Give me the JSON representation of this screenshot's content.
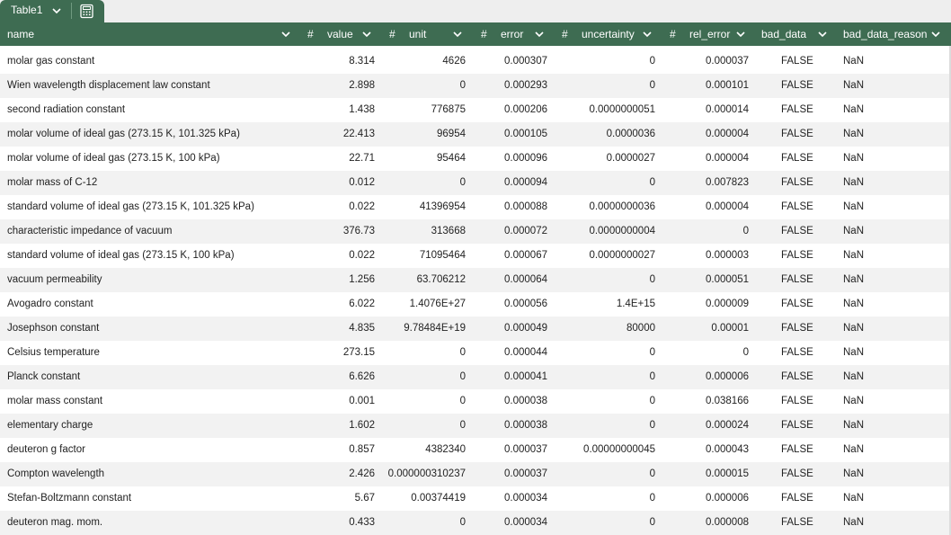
{
  "tab": {
    "label": "Table1"
  },
  "headers": {
    "name": "name",
    "value": "value",
    "unit": "unit",
    "error": "error",
    "uncertainty": "uncertainty",
    "rel_error": "rel_error",
    "bad_data": "bad_data",
    "bad_data_reason": "bad_data_reason",
    "hash": "#"
  },
  "rows": [
    {
      "name": "molar gas constant",
      "value": "8.314",
      "unit": "4626",
      "error": "0.000307",
      "uncertainty": "0",
      "rel_error": "0.000037",
      "bad_data": "FALSE",
      "bad_data_reason": "NaN"
    },
    {
      "name": "Wien wavelength displacement law constant",
      "value": "2.898",
      "unit": "0",
      "error": "0.000293",
      "uncertainty": "0",
      "rel_error": "0.000101",
      "bad_data": "FALSE",
      "bad_data_reason": "NaN"
    },
    {
      "name": "second radiation constant",
      "value": "1.438",
      "unit": "776875",
      "error": "0.000206",
      "uncertainty": "0.0000000051",
      "rel_error": "0.000014",
      "bad_data": "FALSE",
      "bad_data_reason": "NaN"
    },
    {
      "name": "molar volume of ideal gas (273.15 K, 101.325 kPa)",
      "value": "22.413",
      "unit": "96954",
      "error": "0.000105",
      "uncertainty": "0.0000036",
      "rel_error": "0.000004",
      "bad_data": "FALSE",
      "bad_data_reason": "NaN"
    },
    {
      "name": "molar volume of ideal gas (273.15 K, 100 kPa)",
      "value": "22.71",
      "unit": "95464",
      "error": "0.000096",
      "uncertainty": "0.0000027",
      "rel_error": "0.000004",
      "bad_data": "FALSE",
      "bad_data_reason": "NaN"
    },
    {
      "name": "molar mass of C-12",
      "value": "0.012",
      "unit": "0",
      "error": "0.000094",
      "uncertainty": "0",
      "rel_error": "0.007823",
      "bad_data": "FALSE",
      "bad_data_reason": "NaN"
    },
    {
      "name": "standard volume of ideal gas (273.15 K, 101.325 kPa)",
      "value": "0.022",
      "unit": "41396954",
      "error": "0.000088",
      "uncertainty": "0.0000000036",
      "rel_error": "0.000004",
      "bad_data": "FALSE",
      "bad_data_reason": "NaN"
    },
    {
      "name": "characteristic impedance of vacuum",
      "value": "376.73",
      "unit": "313668",
      "error": "0.000072",
      "uncertainty": "0.0000000004",
      "rel_error": "0",
      "bad_data": "FALSE",
      "bad_data_reason": "NaN"
    },
    {
      "name": "standard volume of ideal gas (273.15 K, 100 kPa)",
      "value": "0.022",
      "unit": "71095464",
      "error": "0.000067",
      "uncertainty": "0.0000000027",
      "rel_error": "0.000003",
      "bad_data": "FALSE",
      "bad_data_reason": "NaN"
    },
    {
      "name": "vacuum permeability",
      "value": "1.256",
      "unit": "63.706212",
      "error": "0.000064",
      "uncertainty": "0",
      "rel_error": "0.000051",
      "bad_data": "FALSE",
      "bad_data_reason": "NaN"
    },
    {
      "name": "Avogadro constant",
      "value": "6.022",
      "unit": "1.4076E+27",
      "error": "0.000056",
      "uncertainty": "1.4E+15",
      "rel_error": "0.000009",
      "bad_data": "FALSE",
      "bad_data_reason": "NaN"
    },
    {
      "name": "Josephson constant",
      "value": "4.835",
      "unit": "9.78484E+19",
      "error": "0.000049",
      "uncertainty": "80000",
      "rel_error": "0.00001",
      "bad_data": "FALSE",
      "bad_data_reason": "NaN"
    },
    {
      "name": "Celsius temperature",
      "value": "273.15",
      "unit": "0",
      "error": "0.000044",
      "uncertainty": "0",
      "rel_error": "0",
      "bad_data": "FALSE",
      "bad_data_reason": "NaN"
    },
    {
      "name": "Planck constant",
      "value": "6.626",
      "unit": "0",
      "error": "0.000041",
      "uncertainty": "0",
      "rel_error": "0.000006",
      "bad_data": "FALSE",
      "bad_data_reason": "NaN"
    },
    {
      "name": "molar mass constant",
      "value": "0.001",
      "unit": "0",
      "error": "0.000038",
      "uncertainty": "0",
      "rel_error": "0.038166",
      "bad_data": "FALSE",
      "bad_data_reason": "NaN"
    },
    {
      "name": "elementary charge",
      "value": "1.602",
      "unit": "0",
      "error": "0.000038",
      "uncertainty": "0",
      "rel_error": "0.000024",
      "bad_data": "FALSE",
      "bad_data_reason": "NaN"
    },
    {
      "name": "deuteron g factor",
      "value": "0.857",
      "unit": "4382340",
      "error": "0.000037",
      "uncertainty": "0.00000000045",
      "rel_error": "0.000043",
      "bad_data": "FALSE",
      "bad_data_reason": "NaN"
    },
    {
      "name": "Compton wavelength",
      "value": "2.426",
      "unit": "0.000000310237",
      "error": "0.000037",
      "uncertainty": "0",
      "rel_error": "0.000015",
      "bad_data": "FALSE",
      "bad_data_reason": "NaN"
    },
    {
      "name": "Stefan-Boltzmann constant",
      "value": "5.67",
      "unit": "0.00374419",
      "error": "0.000034",
      "uncertainty": "0",
      "rel_error": "0.000006",
      "bad_data": "FALSE",
      "bad_data_reason": "NaN"
    },
    {
      "name": "deuteron mag. mom.",
      "value": "0.433",
      "unit": "0",
      "error": "0.000034",
      "uncertainty": "0",
      "rel_error": "0.000008",
      "bad_data": "FALSE",
      "bad_data_reason": "NaN"
    }
  ]
}
